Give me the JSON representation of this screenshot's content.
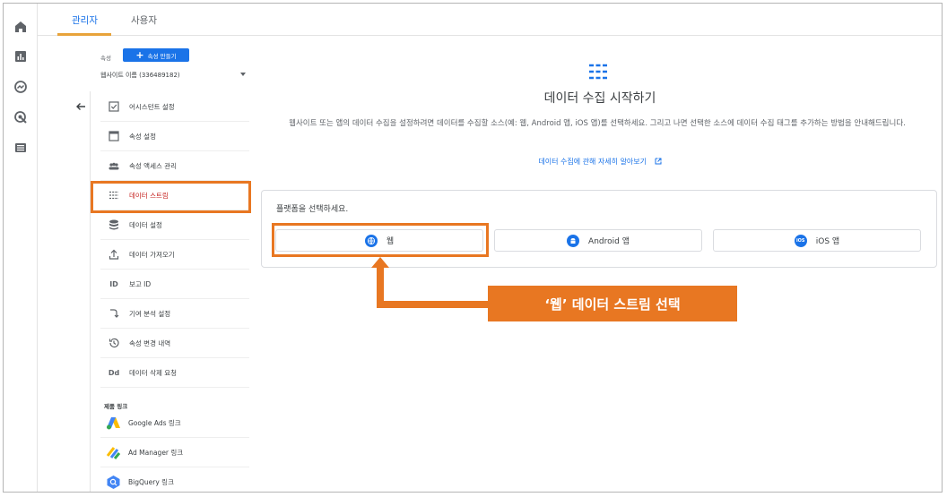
{
  "colors": {
    "accent": "#1a73e8",
    "highlight": "#e87722",
    "active_text": "#c5221f",
    "tab_underline": "#e8a33a"
  },
  "rail": {
    "icons": [
      "home-icon",
      "reports-icon",
      "explore-icon",
      "advertising-icon",
      "configure-icon"
    ]
  },
  "tabs": [
    {
      "label": "관리자",
      "active": true
    },
    {
      "label": "사용자",
      "active": false
    }
  ],
  "property": {
    "label": "속성",
    "create_button": "속성 만들기",
    "selected": "웹사이트 이름 (336489182)"
  },
  "menu": [
    {
      "label": "어시스턴트 설정",
      "icon": "checklist-icon"
    },
    {
      "label": "속성 설정",
      "icon": "settings-panel-icon"
    },
    {
      "label": "속성 액세스 관리",
      "icon": "people-icon"
    },
    {
      "label": "데이터 스트림",
      "icon": "data-stream-icon",
      "active": true
    },
    {
      "label": "데이터 설정",
      "icon": "database-icon"
    },
    {
      "label": "데이터 가져오기",
      "icon": "upload-icon"
    },
    {
      "label": "보고 ID",
      "icon": "reporting-id-icon",
      "icon_text": "ID"
    },
    {
      "label": "기여 분석 설정",
      "icon": "attribution-icon"
    },
    {
      "label": "속성 변경 내역",
      "icon": "history-icon"
    },
    {
      "label": "데이터 삭제 요청",
      "icon": "data-deletion-icon",
      "icon_text": "Dd"
    }
  ],
  "product_links": {
    "section_label": "제품 링크",
    "items": [
      {
        "label": "Google Ads 링크",
        "icon": "google-ads-icon"
      },
      {
        "label": "Ad Manager 링크",
        "icon": "ad-manager-icon"
      },
      {
        "label": "BigQuery 링크",
        "icon": "bigquery-icon"
      }
    ]
  },
  "main": {
    "title": "데이터 수집 시작하기",
    "description": "웹사이트 또는 앱의 데이터 수집을 설정하려면 데이터를 수집할 소스(예: 웹, Android 앱, iOS 앱)를 선택하세요. 그리고 나면 선택한 소스에 데이터 수집 태그를 추가하는 방법을 안내해드립니다.",
    "learn_more": "데이터 수집에 관해 자세히 알아보기",
    "platform_prompt": "플랫폼을 선택하세요.",
    "platforms": [
      {
        "label": "웹",
        "icon": "globe-icon"
      },
      {
        "label": "Android 앱",
        "icon": "android-icon"
      },
      {
        "label": "iOS 앱",
        "icon": "ios-icon",
        "icon_text": "iOS"
      }
    ]
  },
  "annotation": {
    "callout": "‘웹’ 데이터 스트림 선택"
  }
}
